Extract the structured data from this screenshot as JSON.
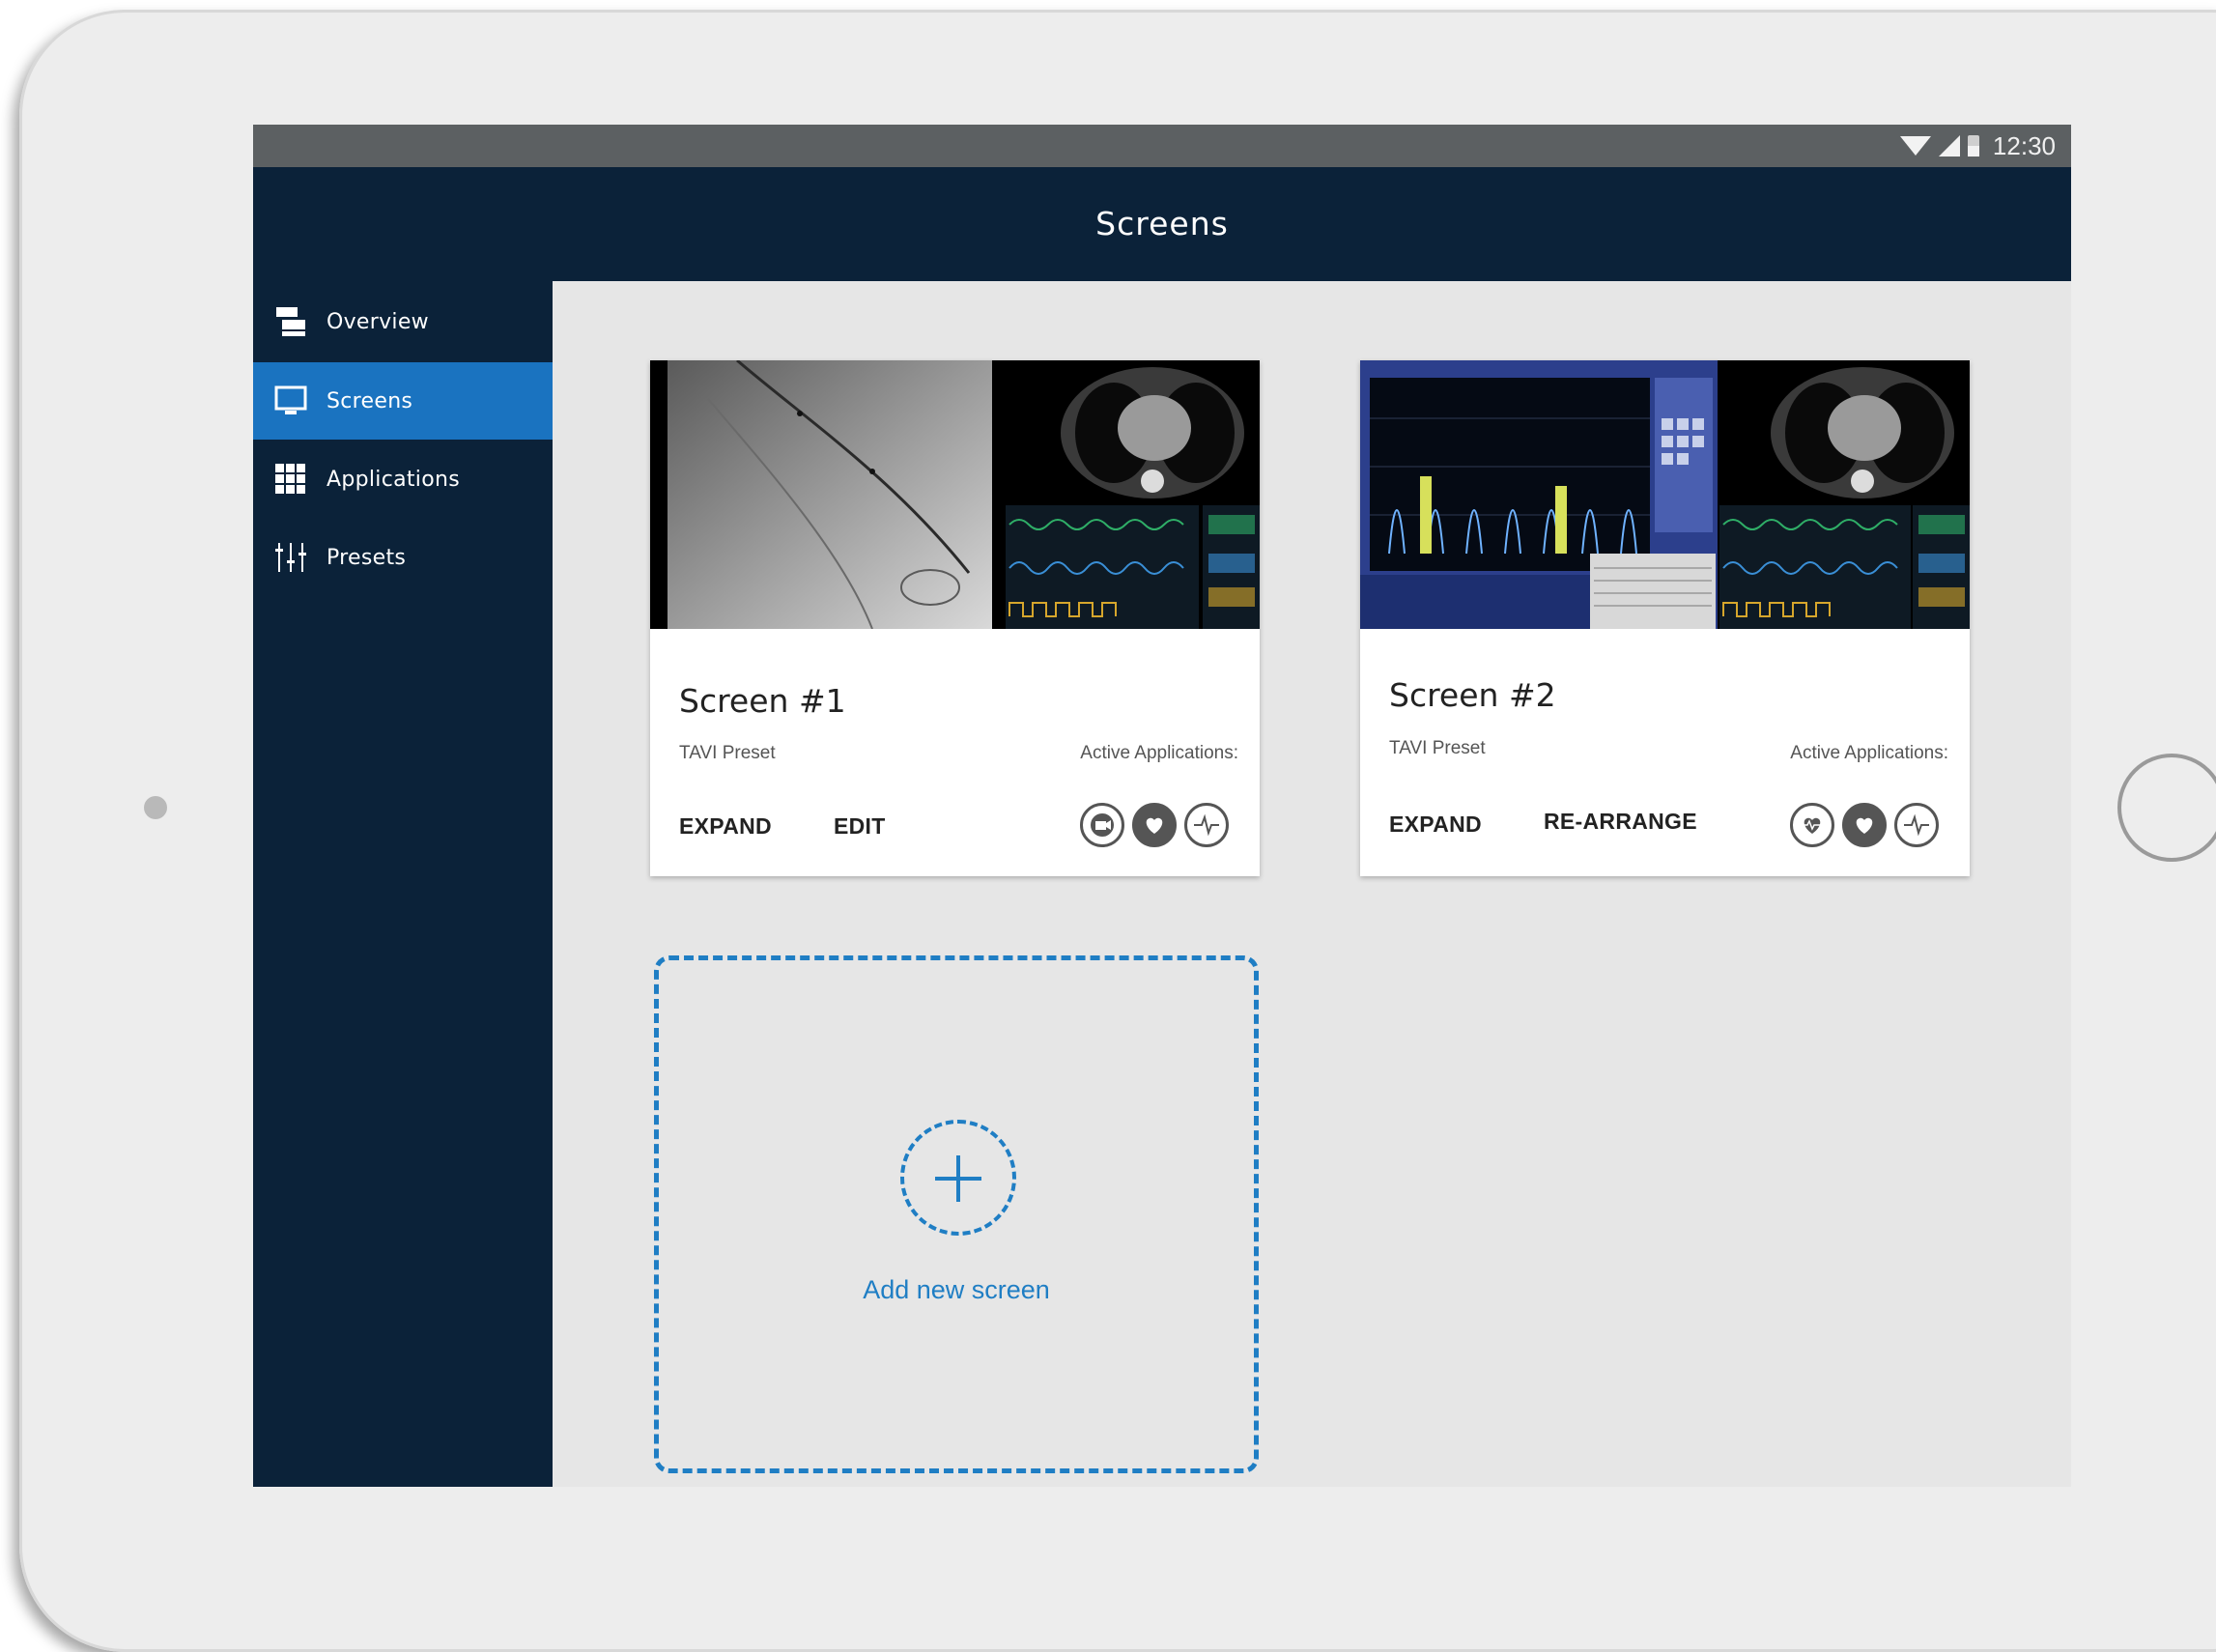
{
  "status_bar": {
    "time": "12:30"
  },
  "header": {
    "title": "Screens"
  },
  "sidebar": {
    "items": [
      {
        "label": "Overview",
        "icon": "overview-icon",
        "active": false
      },
      {
        "label": "Screens",
        "icon": "monitor-icon",
        "active": true
      },
      {
        "label": "Applications",
        "icon": "grid-icon",
        "active": false
      },
      {
        "label": "Presets",
        "icon": "sliders-icon",
        "active": false
      }
    ]
  },
  "cards": [
    {
      "title": "Screen #1",
      "preset": "TAVI Preset",
      "active_label": "Active Applications:",
      "actions": [
        "EXPAND",
        "EDIT"
      ],
      "apps": [
        "video-camera-icon",
        "heart-icon",
        "pulse-icon"
      ]
    },
    {
      "title": "Screen #2",
      "preset": "TAVI Preset",
      "active_label": "Active Applications:",
      "actions": [
        "EXPAND",
        "RE-ARRANGE"
      ],
      "apps": [
        "heart-scan-icon",
        "heart-icon",
        "pulse-icon"
      ]
    }
  ],
  "add_screen": {
    "label": "Add new screen"
  },
  "colors": {
    "navy": "#0b2239",
    "accent_blue": "#1a73c0",
    "dashed_blue": "#1f7ec4",
    "content_bg": "#e6e6e6"
  }
}
